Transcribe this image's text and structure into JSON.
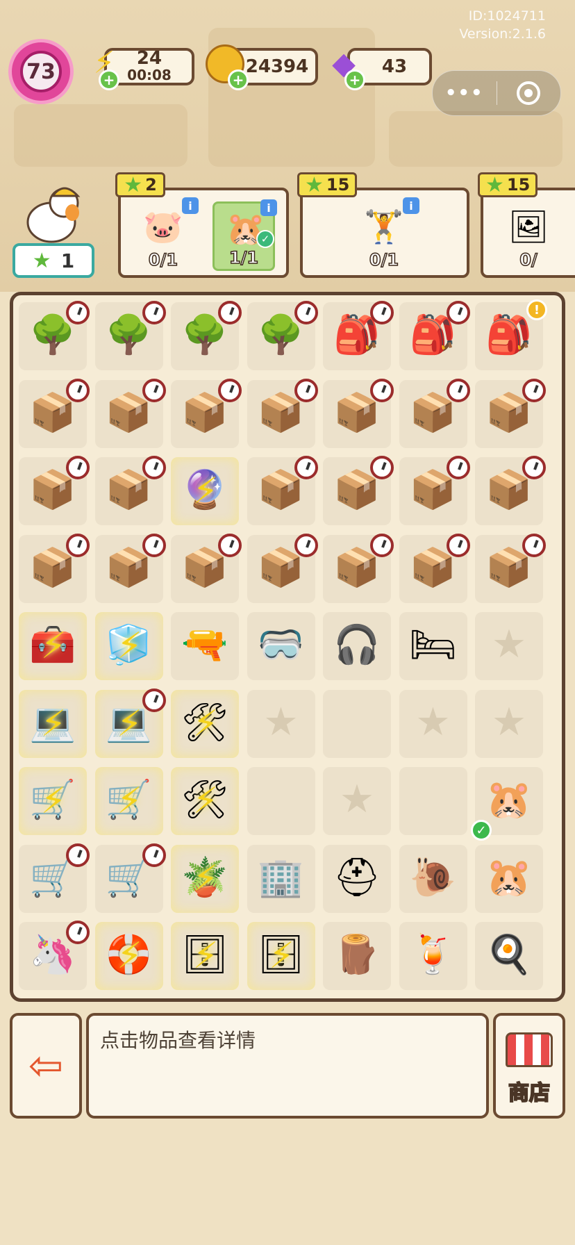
{
  "header": {
    "id_text": "ID:1024711",
    "version_text": "Version:2.1.6",
    "level": "73",
    "energy": {
      "value": "24",
      "timer": "00:08",
      "icon": "lightning-icon"
    },
    "coins": {
      "value": "24394",
      "icon": "coin-icon"
    },
    "gems": {
      "value": "43",
      "icon": "gem-icon"
    },
    "menu_dots": "•••"
  },
  "orders": {
    "stars_total": "1",
    "cards": [
      {
        "reward": "2",
        "items": [
          {
            "icon": "pig-balloon-icon",
            "glyph": "🐷",
            "count": "0/1"
          },
          {
            "icon": "hamster-icon",
            "glyph": "🐹",
            "count": "1/1",
            "done": true
          }
        ]
      },
      {
        "reward": "15",
        "items": [
          {
            "icon": "fat-goose-gym-icon",
            "glyph": "🏋",
            "count": "0/1"
          }
        ]
      },
      {
        "reward": "15",
        "items": [
          {
            "icon": "photo-cards-icon",
            "glyph": "🖼",
            "count": "0/"
          }
        ]
      }
    ]
  },
  "board": {
    "rows": [
      [
        {
          "n": "tree",
          "g": "🌳",
          "c": 1
        },
        {
          "n": "tree",
          "g": "🌳",
          "c": 1
        },
        {
          "n": "tree",
          "g": "🌳",
          "c": 1
        },
        {
          "n": "tree",
          "g": "🌳",
          "c": 1
        },
        {
          "n": "sack",
          "g": "🎒",
          "c": 1
        },
        {
          "n": "sack",
          "g": "🎒",
          "c": 1
        },
        {
          "n": "pink-backpack",
          "g": "🎒",
          "x": 1
        }
      ],
      [
        {
          "n": "locked-crate",
          "g": "📦",
          "c": 1
        },
        {
          "n": "locked-crate",
          "g": "📦",
          "c": 1
        },
        {
          "n": "locked-crate",
          "g": "📦",
          "c": 1
        },
        {
          "n": "locked-crate",
          "g": "📦",
          "c": 1
        },
        {
          "n": "locked-crate",
          "g": "📦",
          "c": 1
        },
        {
          "n": "locked-crate",
          "g": "📦",
          "c": 1
        },
        {
          "n": "locked-crate",
          "g": "📦",
          "c": 1
        }
      ],
      [
        {
          "n": "locked-crate",
          "g": "📦",
          "c": 1
        },
        {
          "n": "locked-crate",
          "g": "📦",
          "c": 1
        },
        {
          "n": "energy-orb",
          "g": "🔮",
          "b": 1
        },
        {
          "n": "locked-crate",
          "g": "📦",
          "c": 1
        },
        {
          "n": "locked-crate",
          "g": "📦",
          "c": 1
        },
        {
          "n": "locked-crate",
          "g": "📦",
          "c": 1
        },
        {
          "n": "locked-crate",
          "g": "📦",
          "c": 1
        }
      ],
      [
        {
          "n": "locked-crate",
          "g": "📦",
          "c": 1
        },
        {
          "n": "locked-crate",
          "g": "📦",
          "c": 1
        },
        {
          "n": "locked-crate",
          "g": "📦",
          "c": 1
        },
        {
          "n": "locked-crate",
          "g": "📦",
          "c": 1
        },
        {
          "n": "locked-crate",
          "g": "📦",
          "c": 1
        },
        {
          "n": "locked-crate",
          "g": "📦",
          "c": 1
        },
        {
          "n": "locked-crate",
          "g": "📦",
          "c": 1
        }
      ],
      [
        {
          "n": "green-chest",
          "g": "🧰",
          "b": 1
        },
        {
          "n": "ice-box",
          "g": "🧊",
          "b": 1
        },
        {
          "n": "blue-hairdryer",
          "g": "🔫"
        },
        {
          "n": "vr-headset",
          "g": "🥽"
        },
        {
          "n": "earbuds",
          "g": "🎧"
        },
        {
          "n": "blue-pillow",
          "g": "🛏"
        },
        {
          "n": "empty",
          "g": "★",
          "e": 1
        }
      ],
      [
        {
          "n": "laptop",
          "g": "💻",
          "b": 1
        },
        {
          "n": "laptop",
          "g": "💻",
          "b": 1,
          "c": 1
        },
        {
          "n": "tool-cart",
          "g": "🛠",
          "b": 1
        },
        {
          "n": "empty",
          "g": "★",
          "e": 1
        },
        {
          "n": "empty",
          "g": "",
          "e": 1
        },
        {
          "n": "empty",
          "g": "★",
          "e": 1
        },
        {
          "n": "empty",
          "g": "★",
          "e": 1
        }
      ],
      [
        {
          "n": "cart",
          "g": "🛒",
          "b": 1
        },
        {
          "n": "cart",
          "g": "🛒",
          "b": 1
        },
        {
          "n": "wheelbarrow",
          "g": "🛠",
          "b": 1
        },
        {
          "n": "empty",
          "g": "",
          "e": 1
        },
        {
          "n": "empty",
          "g": "★",
          "e": 1
        },
        {
          "n": "empty",
          "g": "",
          "e": 1
        },
        {
          "n": "hamster",
          "g": "🐹",
          "t": 1
        }
      ],
      [
        {
          "n": "duck-cart",
          "g": "🛒",
          "c": 1
        },
        {
          "n": "duck-cart",
          "g": "🛒",
          "c": 1
        },
        {
          "n": "pot-plant",
          "g": "🪴",
          "b": 1
        },
        {
          "n": "building",
          "g": "🏢"
        },
        {
          "n": "helmet",
          "g": "⛑"
        },
        {
          "n": "snail",
          "g": "🐌"
        },
        {
          "n": "hamster-family",
          "g": "🐹"
        }
      ],
      [
        {
          "n": "unicorn-float",
          "g": "🦄",
          "c": 1
        },
        {
          "n": "float",
          "g": "🛟",
          "b": 1
        },
        {
          "n": "cabinet",
          "g": "🗄",
          "b": 1
        },
        {
          "n": "cabinet",
          "g": "🗄",
          "b": 1
        },
        {
          "n": "firewood",
          "g": "🪵"
        },
        {
          "n": "juice",
          "g": "🍹"
        },
        {
          "n": "frying-pan",
          "g": "🍳"
        }
      ]
    ]
  },
  "bottom": {
    "hint": "点击物品查看详情",
    "shop_label": "商店",
    "exit_icon": "exit-icon"
  },
  "colors": {
    "border": "#6b4a31",
    "star": "#5fb83c",
    "bolt": "#f4d21c",
    "level": "#e1469a"
  }
}
